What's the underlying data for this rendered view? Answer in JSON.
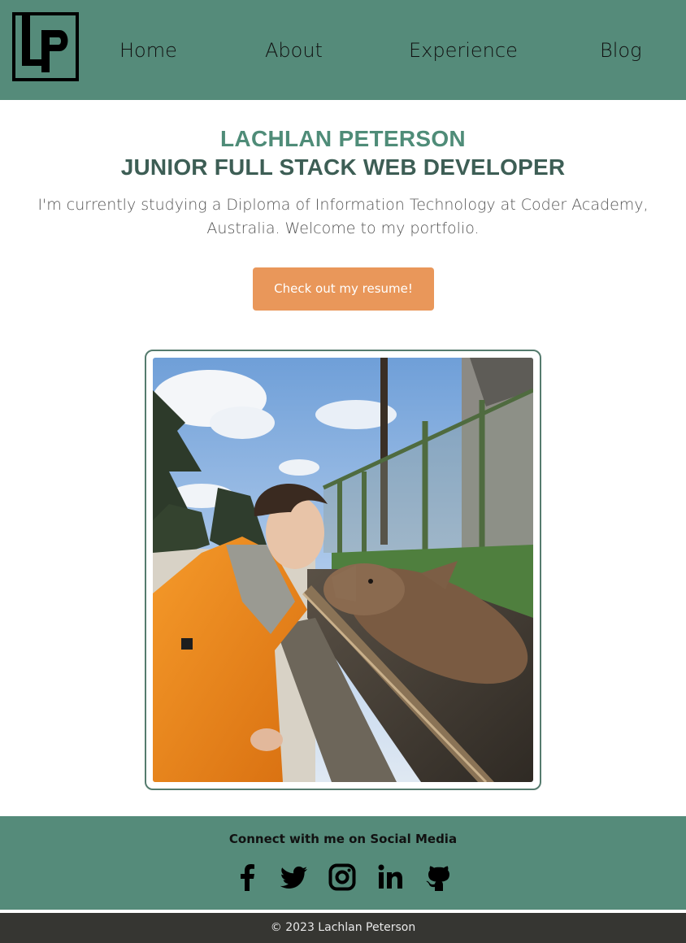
{
  "brand": {
    "logo_icon": "lp-logo-icon",
    "logo_text": "LP",
    "header_color": "#558b7a"
  },
  "nav": {
    "items": [
      {
        "label": "Home"
      },
      {
        "label": "About"
      },
      {
        "label": "Experience"
      },
      {
        "label": "Blog"
      }
    ]
  },
  "hero": {
    "name": "LACHLAN PETERSON",
    "role": "JUNIOR FULL STACK WEB DEVELOPER",
    "intro": "I'm currently studying a Diploma of Information Technology at Coder Academy, Australia. Welcome to my portfolio.",
    "resume_button": "Check out my resume!",
    "name_color": "#4f8c78",
    "role_color": "#3d5e55",
    "button_color": "#e9975a"
  },
  "photo": {
    "subject": "photo-of-person-feeding-deer"
  },
  "social": {
    "title": "Connect with me on Social Media",
    "icons": [
      "facebook-icon",
      "twitter-icon",
      "instagram-icon",
      "linkedin-icon",
      "github-icon"
    ]
  },
  "footer": {
    "copyright": "© 2023 Lachlan Peterson",
    "background": "#363632"
  }
}
